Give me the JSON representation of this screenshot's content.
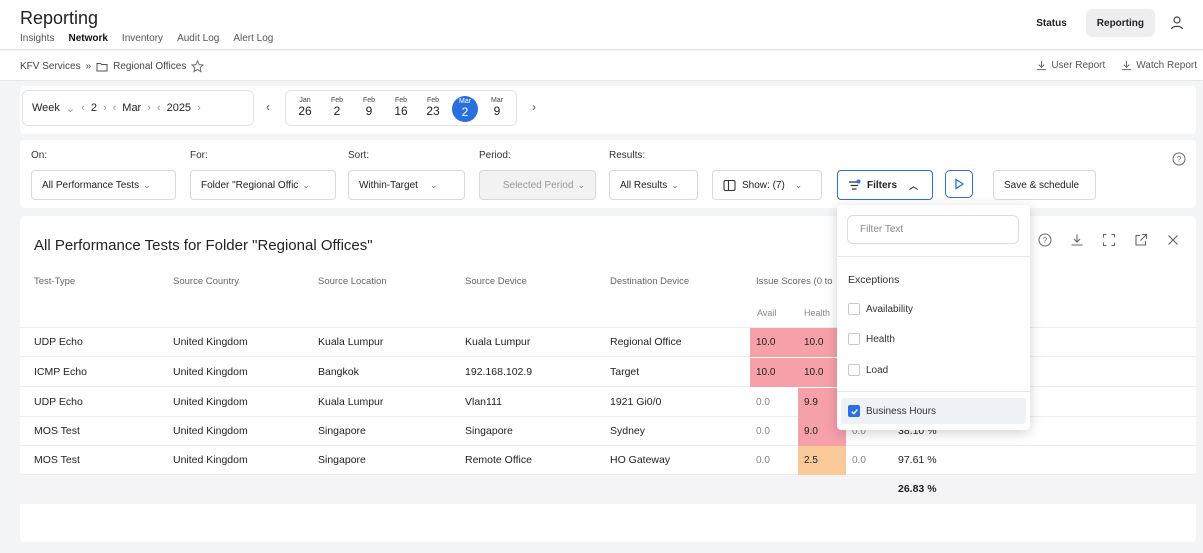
{
  "app": {
    "title": "Reporting",
    "nav": [
      "Insights",
      "Network",
      "Inventory",
      "Audit Log",
      "Alert Log"
    ],
    "header_buttons": {
      "status": "Status",
      "reporting": "Reporting"
    }
  },
  "breadcrumb": {
    "root": "KFV Services",
    "sep": "»",
    "current": "Regional Offices",
    "actions": {
      "user_report": "User Report",
      "watch_report": "Watch Report"
    }
  },
  "date": {
    "granularity": "Week",
    "week": "2",
    "month": "Mar",
    "year": "2025",
    "days": [
      {
        "m": "Jan",
        "d": "26"
      },
      {
        "m": "Feb",
        "d": "2"
      },
      {
        "m": "Feb",
        "d": "9"
      },
      {
        "m": "Feb",
        "d": "16"
      },
      {
        "m": "Feb",
        "d": "23"
      },
      {
        "m": "Mar",
        "d": "2"
      },
      {
        "m": "Mar",
        "d": "9"
      }
    ]
  },
  "filters": {
    "on_label": "On:",
    "on_value": "All Performance Tests",
    "for_label": "For:",
    "for_value": "Folder \"Regional Offic",
    "sort_label": "Sort:",
    "sort_value": "Within-Target",
    "period_label": "Period:",
    "period_value": "Selected Period",
    "results_label": "Results:",
    "results_value": "All Results",
    "show_label": "Show: (7)",
    "filters_label": "Filters",
    "save_label": "Save & schedule"
  },
  "table": {
    "title": "All Performance Tests for Folder \"Regional Offices\"",
    "columns": [
      "Test-Type",
      "Source Country",
      "Source Location",
      "Source Device",
      "Destination Device",
      "Issue Scores (0 to"
    ],
    "subcolumns": [
      "Avail",
      "Health"
    ],
    "rows": [
      {
        "type": "UDP Echo",
        "country": "United Kingdom",
        "location": "Kuala Lumpur",
        "device": "Kuala Lumpur",
        "dest": "Regional Office",
        "avail": "10.0",
        "health": "10.0",
        "c3": "",
        "pct": ""
      },
      {
        "type": "ICMP Echo",
        "country": "United Kingdom",
        "location": "Bangkok",
        "device": "192.168.102.9",
        "dest": "Target",
        "avail": "10.0",
        "health": "10.0",
        "c3": "",
        "pct": ""
      },
      {
        "type": "UDP Echo",
        "country": "United Kingdom",
        "location": "Kuala Lumpur",
        "device": "Vlan111",
        "dest": "1921 Gi0/0",
        "avail": "0.0",
        "health": "9.9",
        "c3": "",
        "pct": ""
      },
      {
        "type": "MOS Test",
        "country": "United Kingdom",
        "location": "Singapore",
        "device": "Singapore",
        "dest": "Sydney",
        "avail": "0.0",
        "health": "9.0",
        "c3": "0.0",
        "pct": "38.10 %"
      },
      {
        "type": "MOS Test",
        "country": "United Kingdom",
        "location": "Singapore",
        "device": "Remote Office",
        "dest": "HO Gateway",
        "avail": "0.0",
        "health": "2.5",
        "c3": "0.0",
        "pct": "97.61 %"
      }
    ],
    "total": "26.83 %"
  },
  "dropdown": {
    "placeholder": "Filter Text",
    "section": "Exceptions",
    "items": [
      {
        "label": "Availability",
        "checked": false
      },
      {
        "label": "Health",
        "checked": false
      },
      {
        "label": "Load",
        "checked": false
      }
    ],
    "business_hours": {
      "label": "Business Hours",
      "checked": true
    }
  },
  "colors": {
    "accent": "#2a6fe0",
    "bad": "#f6a0aa",
    "warn": "#f9c99a"
  }
}
